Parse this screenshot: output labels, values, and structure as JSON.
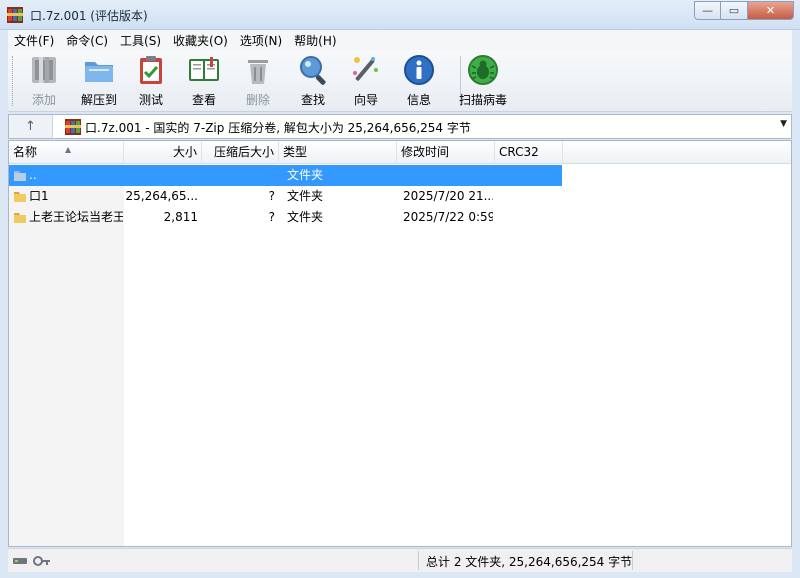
{
  "window": {
    "title": "口.7z.001 (评估版本)",
    "controls": {
      "minimize": "—",
      "maximize": "▭",
      "close": "✕"
    }
  },
  "menubar": {
    "items": [
      {
        "label": "文件(F)"
      },
      {
        "label": "命令(C)"
      },
      {
        "label": "工具(S)"
      },
      {
        "label": "收藏夹(O)"
      },
      {
        "label": "选项(N)"
      },
      {
        "label": "帮助(H)"
      }
    ]
  },
  "toolbar": {
    "buttons": [
      {
        "label": "添加",
        "icon": "archive-add-icon",
        "enabled": false
      },
      {
        "label": "解压到",
        "icon": "extract-folder-icon",
        "enabled": true
      },
      {
        "label": "测试",
        "icon": "test-clipboard-icon",
        "enabled": true
      },
      {
        "label": "查看",
        "icon": "view-book-icon",
        "enabled": true
      },
      {
        "label": "删除",
        "icon": "trash-icon",
        "enabled": false
      },
      {
        "label": "查找",
        "icon": "magnifier-icon",
        "enabled": true
      },
      {
        "label": "向导",
        "icon": "wizard-wand-icon",
        "enabled": true
      },
      {
        "label": "信息",
        "icon": "info-icon",
        "enabled": true
      },
      {
        "label": "扫描病毒",
        "icon": "virus-scan-icon",
        "enabled": true
      }
    ]
  },
  "addressbar": {
    "up_icon": "↑",
    "text": "口.7z.001 - 国实的 7-Zip 压缩分卷, 解包大小为 25,264,656,254 字节",
    "dropdown_icon": "▼"
  },
  "columns": {
    "name": "名称",
    "size": "大小",
    "packed": "压缩后大小",
    "type": "类型",
    "modified": "修改时间",
    "crc": "CRC32"
  },
  "rows": [
    {
      "name": "..",
      "size": "",
      "packed": "",
      "type": "文件夹",
      "modified": "",
      "crc": "",
      "selected": true,
      "icon": "parent-folder-icon"
    },
    {
      "name": "口1",
      "size": "25,264,65...",
      "packed": "?",
      "type": "文件夹",
      "modified": "2025/7/20 21...",
      "crc": "",
      "selected": false,
      "icon": "folder-icon"
    },
    {
      "name": "上老王论坛当老王",
      "size": "2,811",
      "packed": "?",
      "type": "文件夹",
      "modified": "2025/7/22 0:59",
      "crc": "",
      "selected": false,
      "icon": "folder-icon"
    }
  ],
  "statusbar": {
    "summary": "总计 2 文件夹, 25,264,656,254 字节"
  },
  "colors": {
    "selection": "#3399ff",
    "title_bar": "#dbe7f4",
    "folder": "#e8c35a"
  }
}
